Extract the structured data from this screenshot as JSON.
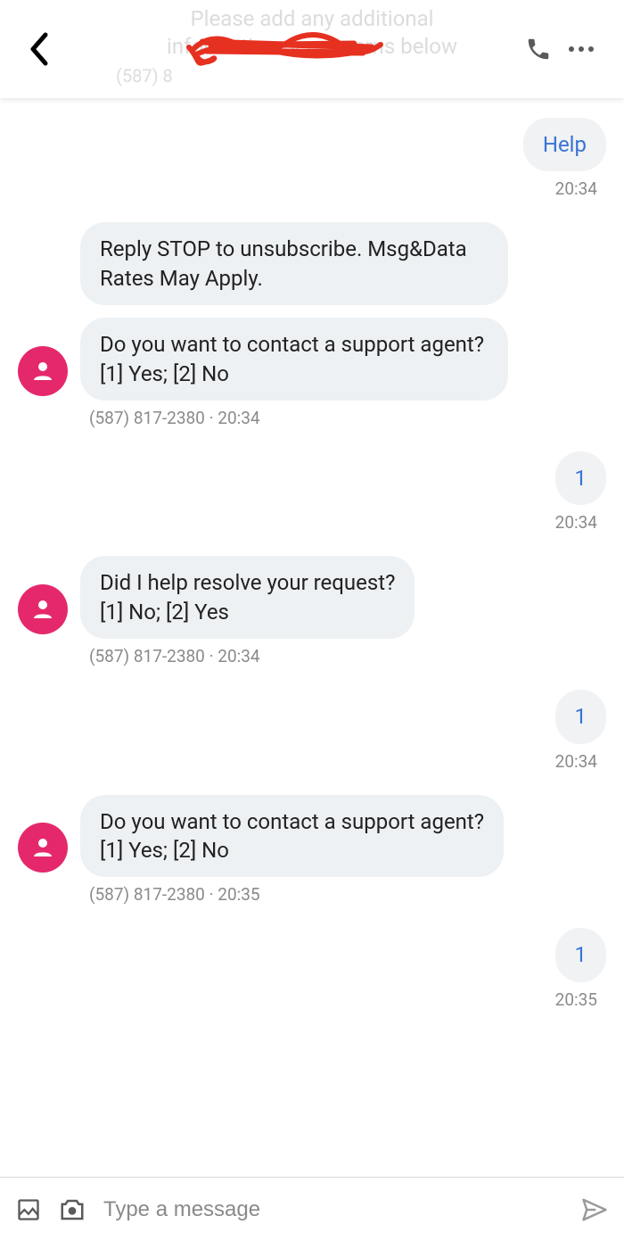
{
  "header": {
    "bg_line1": "Please add any additional",
    "bg_line2": "information or concerns below",
    "bg_phone_fragment": "(587) 8"
  },
  "messages": [
    {
      "dir": "out",
      "text": "Help",
      "time": "20:34"
    },
    {
      "dir": "in",
      "text": "Reply STOP to unsubscribe. Msg&Data Rates May Apply.",
      "stacked": true
    },
    {
      "dir": "in",
      "text": "Do you want to contact a support agent?\n[1] Yes; [2] No",
      "sender": "(587) 817-2380",
      "time": "20:34",
      "avatar": true,
      "stackedEnd": true
    },
    {
      "dir": "out",
      "text": "1",
      "time": "20:34"
    },
    {
      "dir": "in",
      "text": "Did I help resolve your request?\n[1] No; [2] Yes",
      "sender": "(587) 817-2380",
      "time": "20:34",
      "avatar": true
    },
    {
      "dir": "out",
      "text": "1",
      "time": "20:34"
    },
    {
      "dir": "in",
      "text": "Do you want to contact a support agent?\n[1] Yes; [2] No",
      "sender": "(587) 817-2380",
      "time": "20:35",
      "avatar": true
    },
    {
      "dir": "out",
      "text": "1",
      "time": "20:35"
    }
  ],
  "input": {
    "placeholder": "Type a message"
  }
}
